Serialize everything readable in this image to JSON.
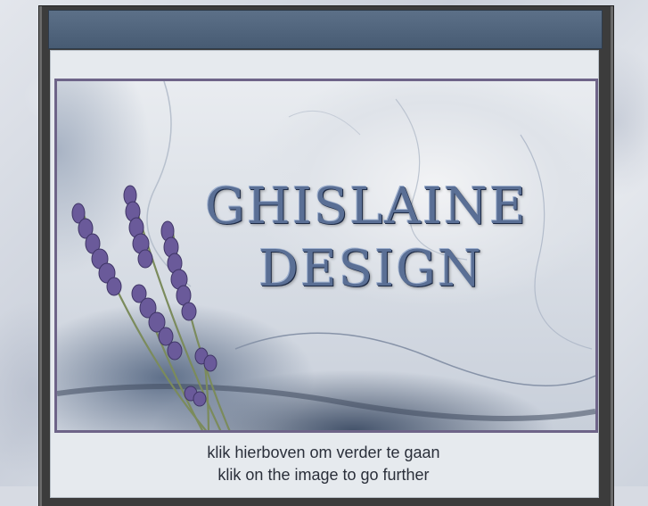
{
  "banner": {
    "title_line1": "GHISLAINE",
    "title_line2": "DESIGN"
  },
  "captions": {
    "dutch": "klik hierboven om verder te gaan",
    "english": "klik on the image to go further"
  },
  "colors": {
    "header": "#475b73",
    "frame": "#3c3c3c",
    "banner_border": "#6e6488",
    "title": "#5a6f95",
    "lavender": "#6a5a9a"
  },
  "icons": [
    "lavender-sprig-icon"
  ]
}
